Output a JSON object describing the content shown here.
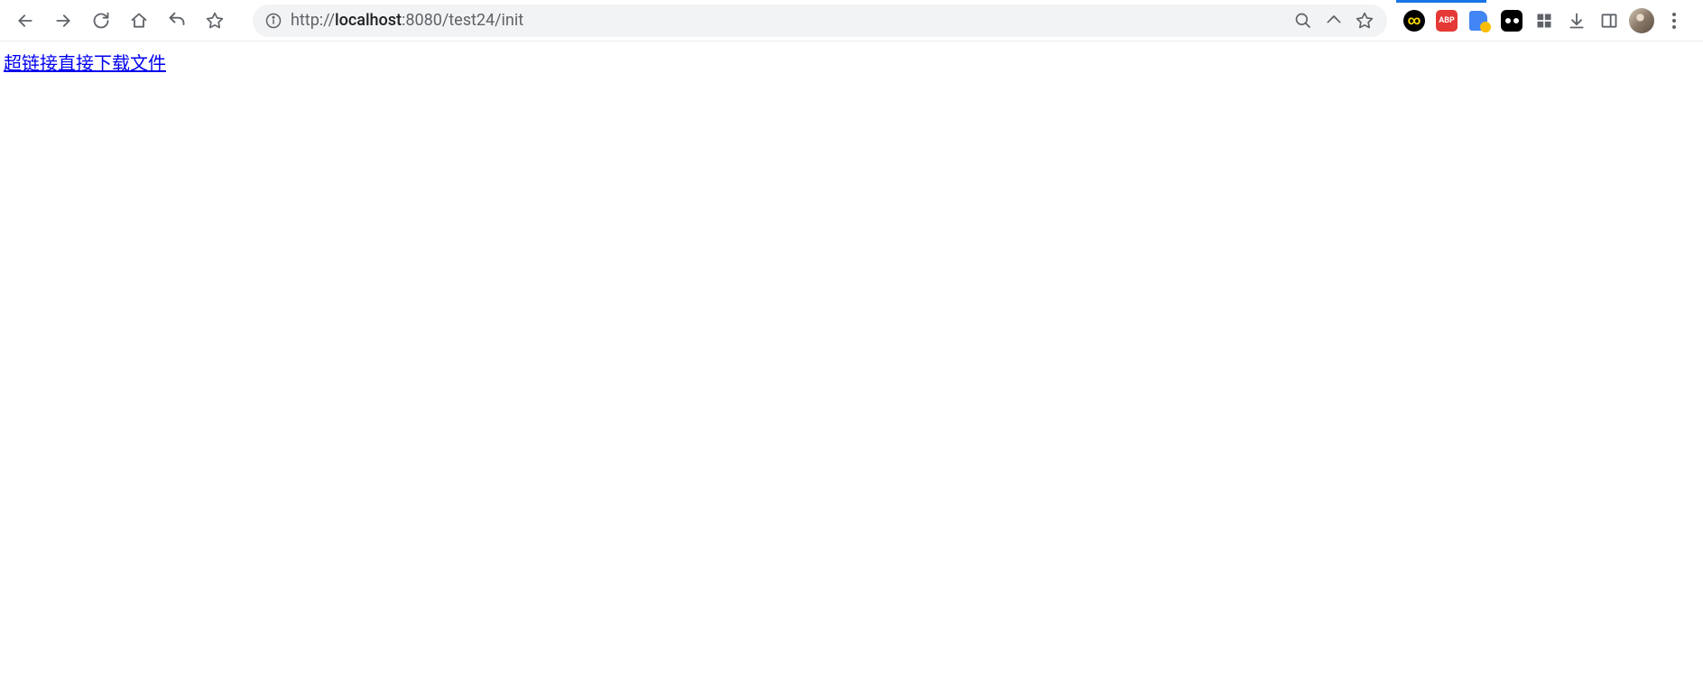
{
  "browser": {
    "url_protocol": "http://",
    "url_host": "localhost",
    "url_port_path": ":8080/test24/init",
    "full_url": "http://localhost:8080/test24/init"
  },
  "extensions": {
    "abp_label": "ABP",
    "infinity_symbol": "∞"
  },
  "page": {
    "download_link_text": "超链接直接下载文件"
  }
}
